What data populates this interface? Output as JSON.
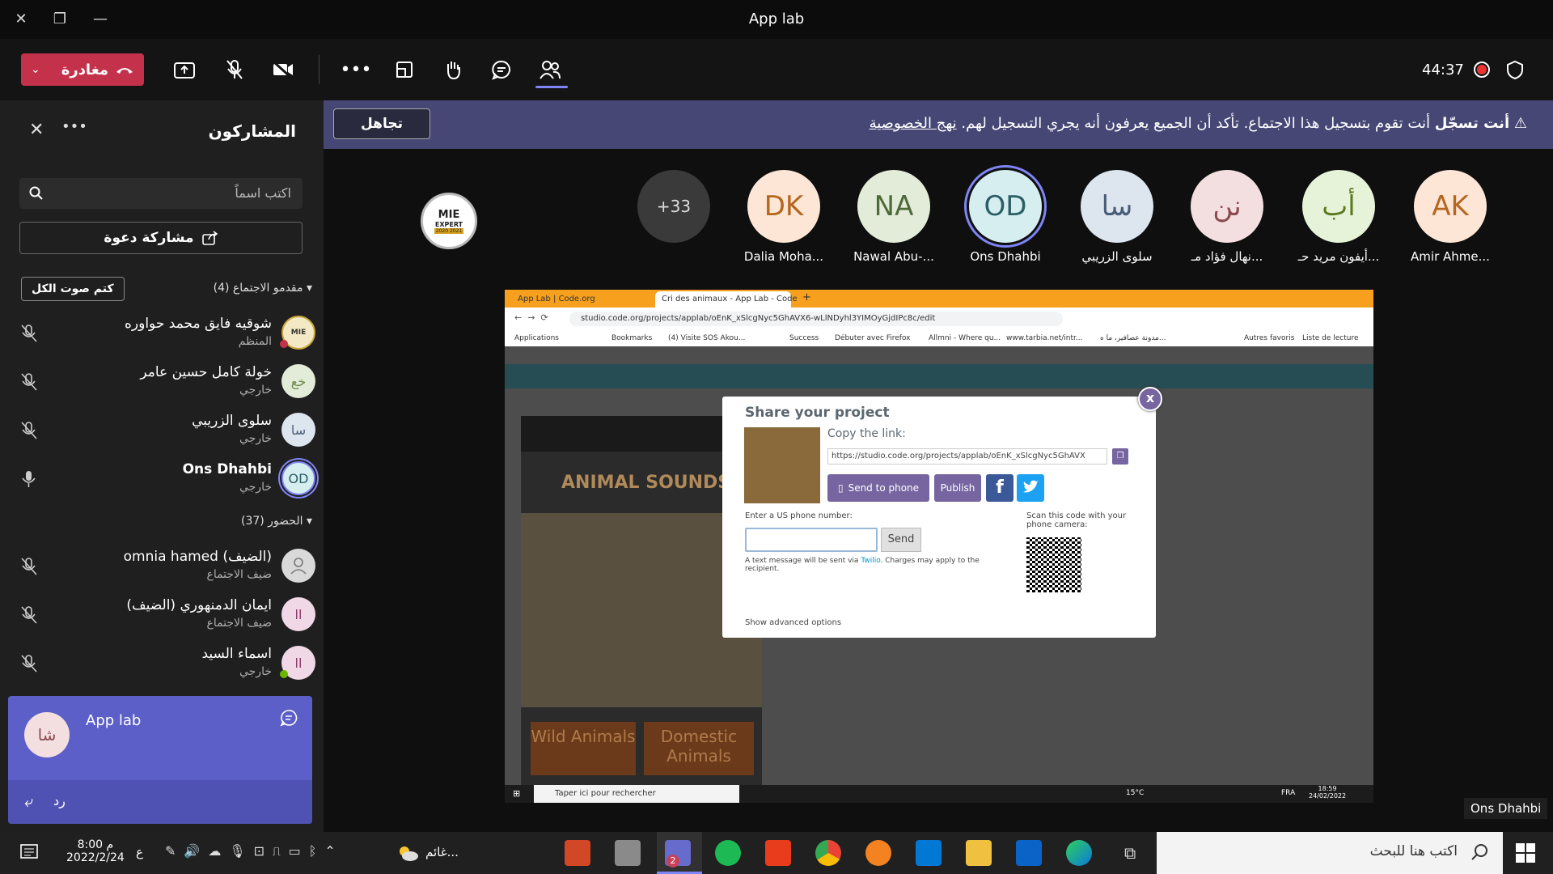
{
  "window": {
    "title": "App lab"
  },
  "toolbar": {
    "leave_label": "مغادرة",
    "timer": "44:37"
  },
  "banner": {
    "bold": "أنت تسجّل",
    "message": "أنت تقوم بتسجيل هذا الاجتماع. تأكد أن الجميع يعرفون أنه يجري التسجيل لهم.",
    "link": "نهج الخصوصية",
    "dismiss_label": "تجاهل"
  },
  "panel": {
    "title": "المشاركون",
    "search_placeholder": "اكتب اسماً",
    "share_invite": "مشاركة دعوة",
    "mute_all": "كتم صوت الكل",
    "presenters_header": "مقدمو الاجتماع (4)",
    "attendees_header": "الحضور (37)",
    "presenters": [
      {
        "name": "شوقيه فايق محمد حواوره",
        "role": "المنظم",
        "initials": ""
      },
      {
        "name": "خولة كامل حسين عامر",
        "role": "خارجي",
        "initials": "خع"
      },
      {
        "name": "سلوى الزريبي",
        "role": "خارجي",
        "initials": "سا"
      },
      {
        "name": "Ons Dhahbi",
        "role": "خارجي",
        "initials": "OD"
      }
    ],
    "attendees": [
      {
        "name": "omnia hamed (الضيف)",
        "role": "ضيف الاجتماع",
        "initials": ""
      },
      {
        "name": "ايمان الدمنهوري (الضيف)",
        "role": "ضيف الاجتماع",
        "initials": "اا"
      },
      {
        "name": "اسماء السيد",
        "role": "خارجي",
        "initials": "اا"
      }
    ]
  },
  "tiles": [
    {
      "initials": "AK",
      "name": "Amir Ahme...",
      "bg": "#fde6d6",
      "fg": "#b4671e"
    },
    {
      "initials": "أب",
      "name": "أيفون مريد حـ...",
      "bg": "#e7f3d8",
      "fg": "#5a7a1e"
    },
    {
      "initials": "نن",
      "name": "نهال فؤاد مـ...",
      "bg": "#f4dfe0",
      "fg": "#8a4a4f"
    },
    {
      "initials": "سا",
      "name": "سلوى الزريبي",
      "bg": "#dde5ef",
      "fg": "#4a5d78"
    },
    {
      "initials": "OD",
      "name": "Ons Dhahbi",
      "bg": "#d6eef0",
      "fg": "#2b5f66"
    },
    {
      "initials": "NA",
      "name": "Nawal Abu-...",
      "bg": "#e3ecd9",
      "fg": "#4f6a3a"
    },
    {
      "initials": "DK",
      "name": "Dalia Moha...",
      "bg": "#fde6d6",
      "fg": "#b4671e"
    },
    {
      "initials": "+33",
      "name": "",
      "bg": "#3a3a3a",
      "fg": "#ddd"
    }
  ],
  "mie_badge": {
    "line1": "MIE",
    "line2": "EXPERT",
    "years": "2020 2021"
  },
  "presenter_name": "Ons Dhahbi",
  "screen": {
    "tab1": "App Lab | Code.org",
    "tab2": "Cri des animaux - App Lab - Code",
    "url": "studio.code.org/projects/applab/oEnK_xSlcgNyc5GhAVX6-wLlNDyhl3YIMOyGjdIPc8c/edit",
    "bookmarks": [
      "Applications",
      "Bookmarks",
      "(4) Visite SOS Akou...",
      "Success",
      "Débuter avec Firefox",
      "Allmni - Where qu...",
      "www.tarbia.net/intr...",
      "مدونة عصافير، ما ه...",
      "Autres favoris",
      "Liste de lecture"
    ],
    "app_title": "ANIMAL SOUNDS",
    "btn_wild": "Wild Animals",
    "btn_domestic": "Domestic Animals",
    "modal": {
      "title": "Share your project",
      "copy_link": "Copy the link:",
      "link": "https://studio.code.org/projects/applab/oEnK_xSlcgNyc5GhAVX",
      "send_phone": "Send to phone",
      "publish": "Publish",
      "enter_phone": "Enter a US phone number:",
      "send": "Send",
      "twilio_note": "A text message will be sent via",
      "twilio": "Twilio",
      "twilio_note2": ". Charges may apply to the recipient.",
      "scan": "Scan this code with your phone camera:",
      "advanced": "Show advanced options",
      "close": "x"
    },
    "win_search": "Taper ici pour rechercher",
    "win_temp": "15°C",
    "win_lang": "FRA",
    "win_time": "18:59",
    "win_date": "24/02/2022"
  },
  "chat": {
    "initials": "شا",
    "title": "App lab",
    "reply": "رد"
  },
  "taskbar": {
    "search": "اكتب هنا للبحث",
    "weather": "غائم...",
    "time": "8:00 م",
    "date": "2022/2/24",
    "lang": "ع",
    "teams_badge": "2"
  }
}
